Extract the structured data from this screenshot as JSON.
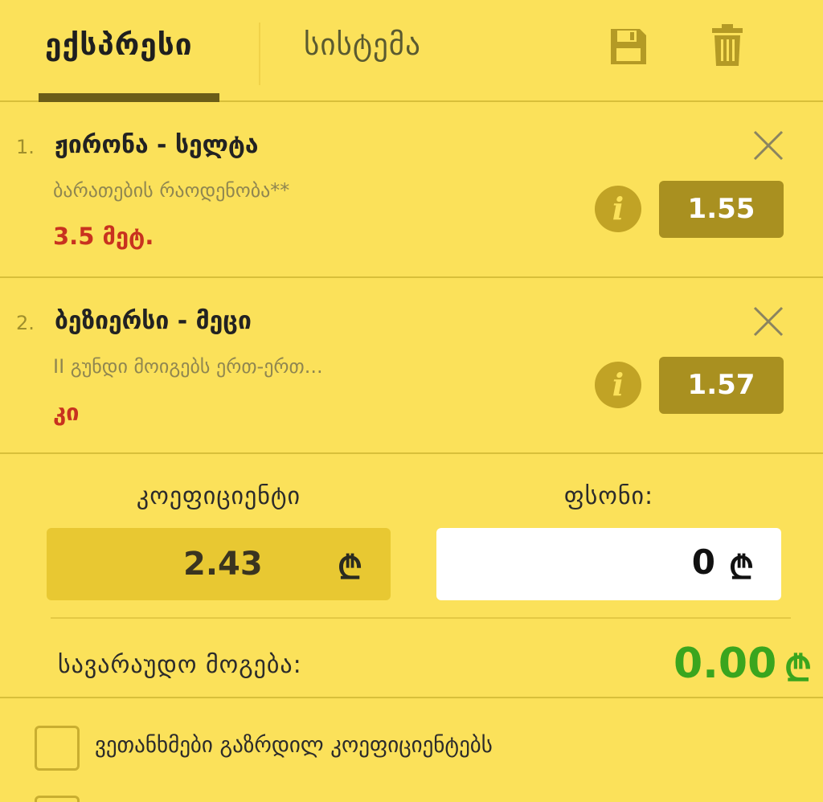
{
  "tabs": {
    "express_label": "ექსპრესი",
    "system_label": "სისტემა"
  },
  "icons": {
    "save": "save-icon",
    "trash": "trash-icon",
    "close": "close-icon",
    "info": "info-icon"
  },
  "bets": [
    {
      "number": "1.",
      "title": "ჟირონა - სელტა",
      "market": "ბარათების რაოდენობა**",
      "pick": "3.5 მეტ.",
      "odds": "1.55",
      "info_glyph": "i"
    },
    {
      "number": "2.",
      "title": "ბეზიერსი - მეცი",
      "market": "II გუნდი მოიგებს ერთ-ერთ...",
      "pick": "კი",
      "odds": "1.57",
      "info_glyph": "i"
    }
  ],
  "summary": {
    "coefficient_label": "კოეფიციენტი",
    "coefficient_value": "2.43",
    "stake_label": "ფსონი:",
    "stake_value": "0",
    "currency_symbol": "₾",
    "potential_win_label": "სავარაუდო მოგება:",
    "potential_win_value": "0.00"
  },
  "options": {
    "accept_higher_odds_label": "ვეთანხმები გაზრდილ კოეფიციენტებს"
  },
  "colors": {
    "background": "#fbe15a",
    "odds_button": "#a99020",
    "pick_red": "#c8321f",
    "win_green": "#3aa51e",
    "tab_underline": "#6b5d18"
  }
}
